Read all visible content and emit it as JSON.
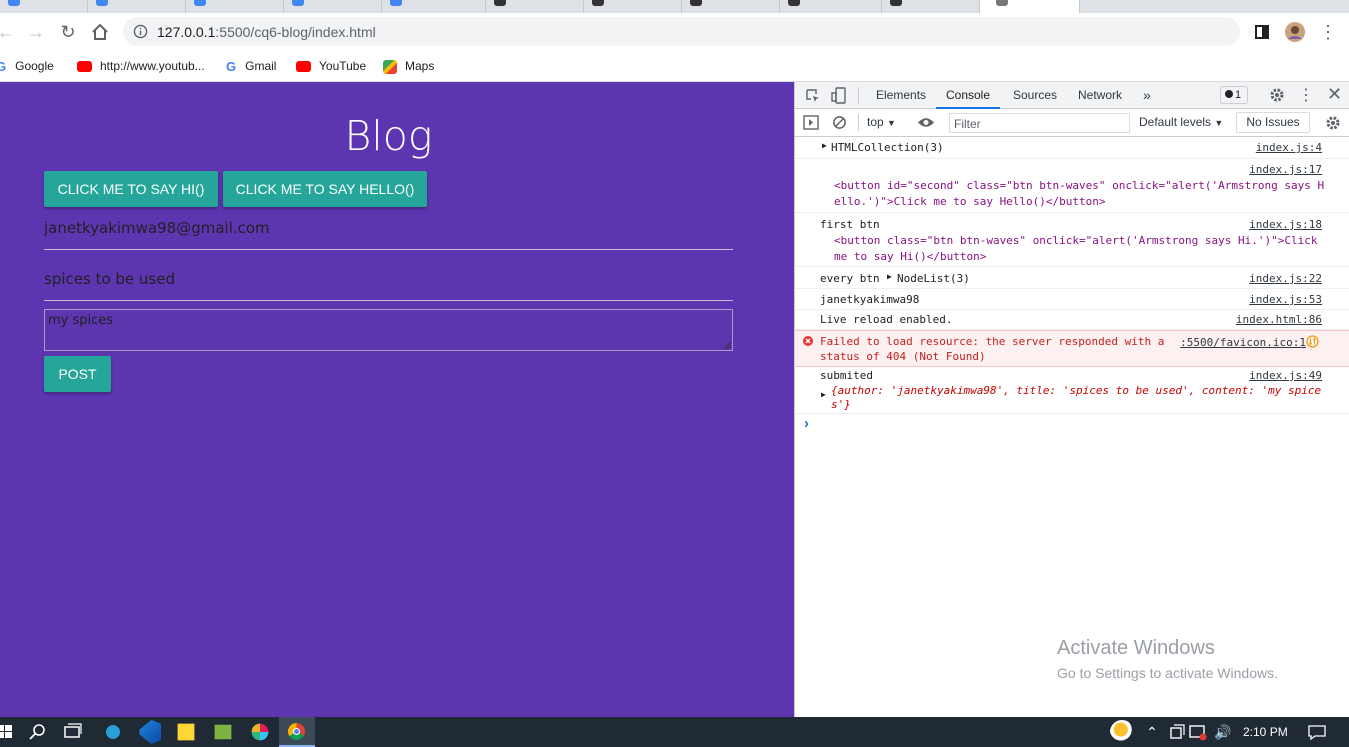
{
  "browser": {
    "url_prefix": "127.0.0.1",
    "url_rest": ":5500/cq6-blog/index.html",
    "bookmarks": [
      {
        "label": "Google",
        "icon": "google-icon"
      },
      {
        "label": "http://www.youtub...",
        "icon": "youtube-icon"
      },
      {
        "label": "Gmail",
        "icon": "google-icon"
      },
      {
        "label": "YouTube",
        "icon": "youtube-icon"
      },
      {
        "label": "Maps",
        "icon": "maps-icon"
      }
    ]
  },
  "page": {
    "title": "Blog",
    "btn_hi": "CLICK ME TO SAY HI()",
    "btn_hello": "CLICK ME TO SAY HELLO()",
    "author_value": "janetkyakimwa98@gmail.com",
    "title_value": "spices to be used",
    "content_value": "my spices",
    "post_label": "POST"
  },
  "devtools": {
    "tabs": [
      "Elements",
      "Console",
      "Sources",
      "Network"
    ],
    "more": "»",
    "issues_badge": "1",
    "context": "top",
    "filter_placeholder": "Filter",
    "levels": "Default levels",
    "issues": "No Issues",
    "logs": {
      "l1_text": "HTMLCollection(3)",
      "l1_src": "index.js:4",
      "l2_src": "index.js:17",
      "l2_a": "<button id=\"second\" class=\"btn btn-waves\" onclick=\"alert('Armstrong says H",
      "l2_b": "ello.')\">Click me to say Hello()</button>",
      "l3_label": "first btn",
      "l3_src": "index.js:18",
      "l3_a": "<button class=\"btn btn-waves\" onclick=\"alert('Armstrong says Hi.')\">Click",
      "l3_b": "me to say Hi()</button>",
      "l4_label": "every btn",
      "l4_text": "NodeList(3)",
      "l4_src": "index.js:22",
      "l5_text": "janetkyakimwa98",
      "l5_src": "index.js:53",
      "l6_text": "Live reload enabled.",
      "l6_src": "index.html:86",
      "l7_a": "Failed to load resource: the server responded with a",
      "l7_b": "status of 404 (Not Found)",
      "l7_src": ":5500/favicon.ico:1",
      "l8_text": "submited",
      "l8_src": "index.js:49",
      "l8_obj_a": "{author: 'janetkyakimwa98', title: 'spices to be used', content: 'my spice",
      "l8_obj_b": "s'}"
    },
    "prompt": "›"
  },
  "watermark": {
    "line1": "Activate Windows",
    "line2": "Go to Settings to activate Windows."
  },
  "taskbar": {
    "time": "2:10 PM"
  }
}
